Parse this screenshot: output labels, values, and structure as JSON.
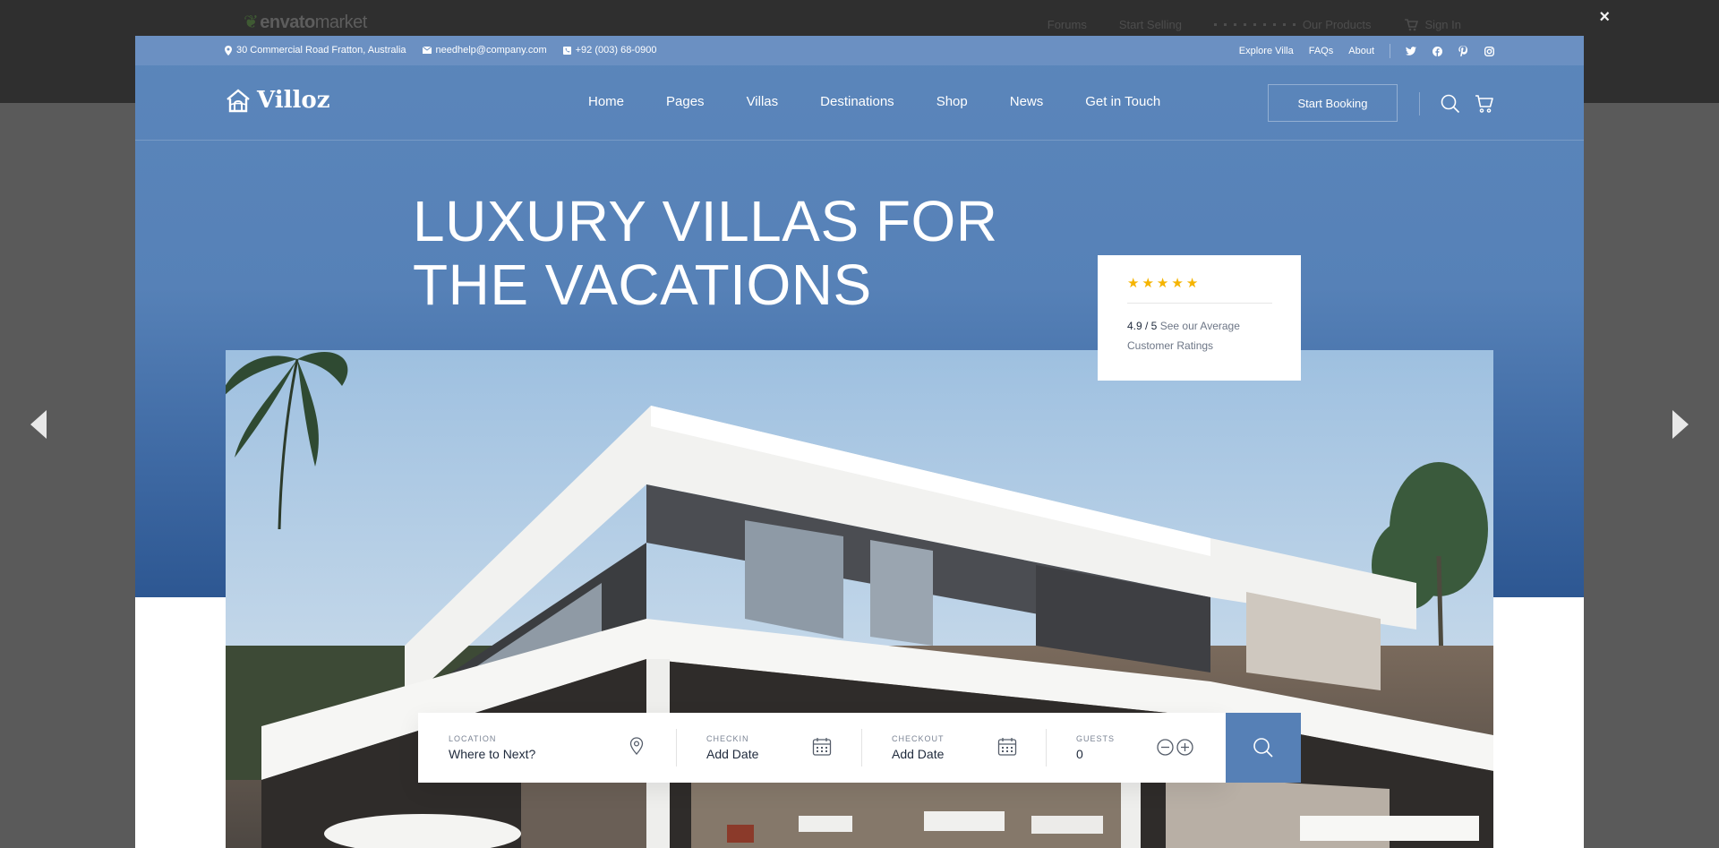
{
  "envato": {
    "logo": "envato",
    "logo_suffix": "market",
    "nav": [
      "Forums",
      "Start Selling",
      "Our Products",
      "Sign In"
    ],
    "close": "×"
  },
  "topbar": {
    "address": "30 Commercial Road Fratton, Australia",
    "email": "needhelp@company.com",
    "phone": "+92 (003) 68-0900",
    "links": [
      "Explore Villa",
      "FAQs",
      "About"
    ],
    "social_icons": [
      "twitter-icon",
      "facebook-icon",
      "pinterest-icon",
      "instagram-icon"
    ]
  },
  "header": {
    "logo": "Villoz",
    "nav": [
      "Home",
      "Pages",
      "Villas",
      "Destinations",
      "Shop",
      "News",
      "Get in Touch"
    ],
    "cta": "Start Booking"
  },
  "hero": {
    "title_line1": "LUXURY VILLAS FOR",
    "title_line2": "THE VACATIONS"
  },
  "rating": {
    "stars": 5,
    "score": "4.9 / 5",
    "text": "See our Average Customer Ratings"
  },
  "search": {
    "location": {
      "label": "LOCATION",
      "value": "Where to Next?"
    },
    "checkin": {
      "label": "CHECKIN",
      "value": "Add Date"
    },
    "checkout": {
      "label": "CHECKOUT",
      "value": "Add Date"
    },
    "guests": {
      "label": "GUESTS",
      "value": "0"
    }
  },
  "colors": {
    "brand_blue": "#5680b6",
    "topbar": "#6b90c2",
    "star": "#f5b400",
    "envato_bar": "#2f2f2f"
  }
}
